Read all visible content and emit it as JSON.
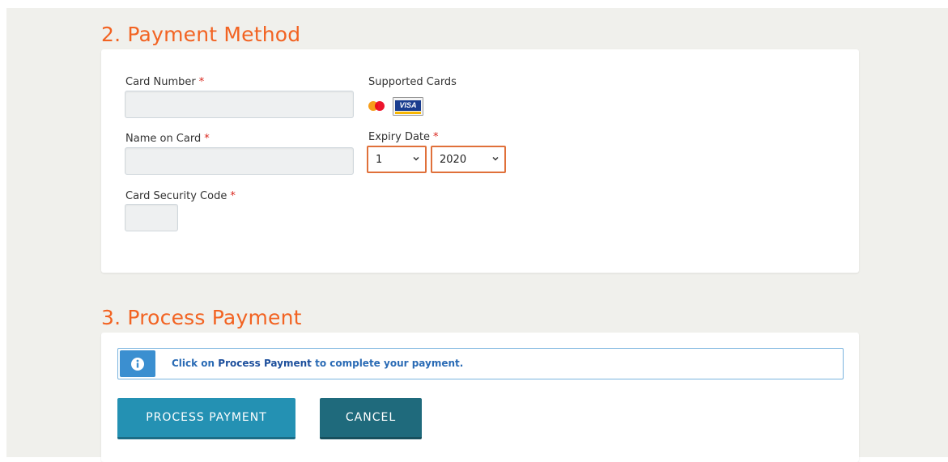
{
  "payment_method": {
    "title": "2. Payment Method",
    "card_number_label": "Card Number",
    "card_number_value": "",
    "supported_cards_label": "Supported Cards",
    "supported_cards": [
      {
        "name": "Mastercard",
        "icon": "mastercard-icon"
      },
      {
        "name": "VISA",
        "icon": "visa-icon"
      }
    ],
    "name_on_card_label": "Name on Card",
    "name_on_card_value": "",
    "expiry_label": "Expiry Date",
    "expiry_month": "1",
    "expiry_year": "2020",
    "security_code_label": "Card Security Code",
    "security_code_value": "",
    "required_marker": "*"
  },
  "process_payment": {
    "title": "3. Process Payment",
    "info_prefix": "Click on ",
    "info_bold": "Process Payment",
    "info_suffix": " to complete your payment.",
    "process_button": "PROCESS PAYMENT",
    "cancel_button": "CANCEL"
  },
  "colors": {
    "accent": "#f26322",
    "required": "#d9251c",
    "process_button": "#2491b3",
    "cancel_button": "#1f6a7c",
    "info_blue": "#3b8fd0"
  }
}
